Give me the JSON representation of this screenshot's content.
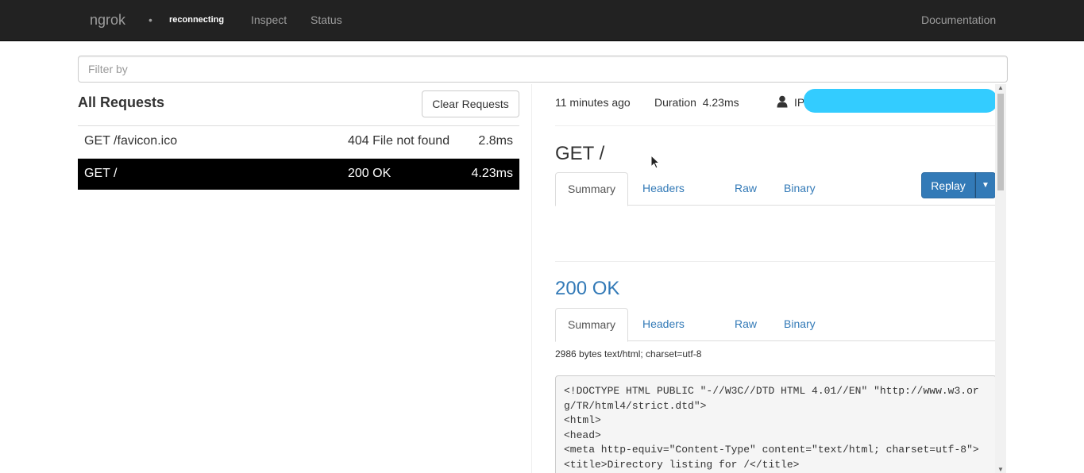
{
  "navbar": {
    "brand": "ngrok",
    "dot": "•",
    "status": "reconnecting",
    "links": {
      "inspect": "Inspect",
      "status": "Status",
      "docs": "Documentation"
    }
  },
  "filter": {
    "placeholder": "Filter by",
    "value": ""
  },
  "requests": {
    "title": "All Requests",
    "clear_label": "Clear Requests",
    "rows": [
      {
        "path": "GET /favicon.ico",
        "status": "404 File not found",
        "duration": "2.8ms",
        "selected": false
      },
      {
        "path": "GET /",
        "status": "200 OK",
        "duration": "4.23ms",
        "selected": true
      }
    ]
  },
  "detail": {
    "time": "11 minutes ago",
    "duration": "Duration  4.23ms",
    "ip_label": "IP",
    "request_heading": "GET /",
    "response_heading": "200 OK",
    "tabs": {
      "summary": "Summary",
      "headers": "Headers",
      "raw": "Raw",
      "binary": "Binary"
    },
    "replay_label": "Replay",
    "body_info": "2986 bytes text/html; charset=utf-8",
    "code_lines": [
      "<!DOCTYPE HTML PUBLIC \"-//W3C//DTD HTML 4.01//EN\" \"http://www.w3.org/TR/html4/strict.dtd\">",
      "<html>",
      "<head>",
      "<meta http-equiv=\"Content-Type\" content=\"text/html; charset=utf-8\">",
      "<title>Directory listing for /</title>"
    ]
  },
  "colors": {
    "navbar": "#222222",
    "link": "#337ab7",
    "selected_row": "#000000",
    "redaction": "#33ccff"
  },
  "icons": [
    "user-icon",
    "caret-down-icon",
    "mouse-cursor-icon"
  ]
}
